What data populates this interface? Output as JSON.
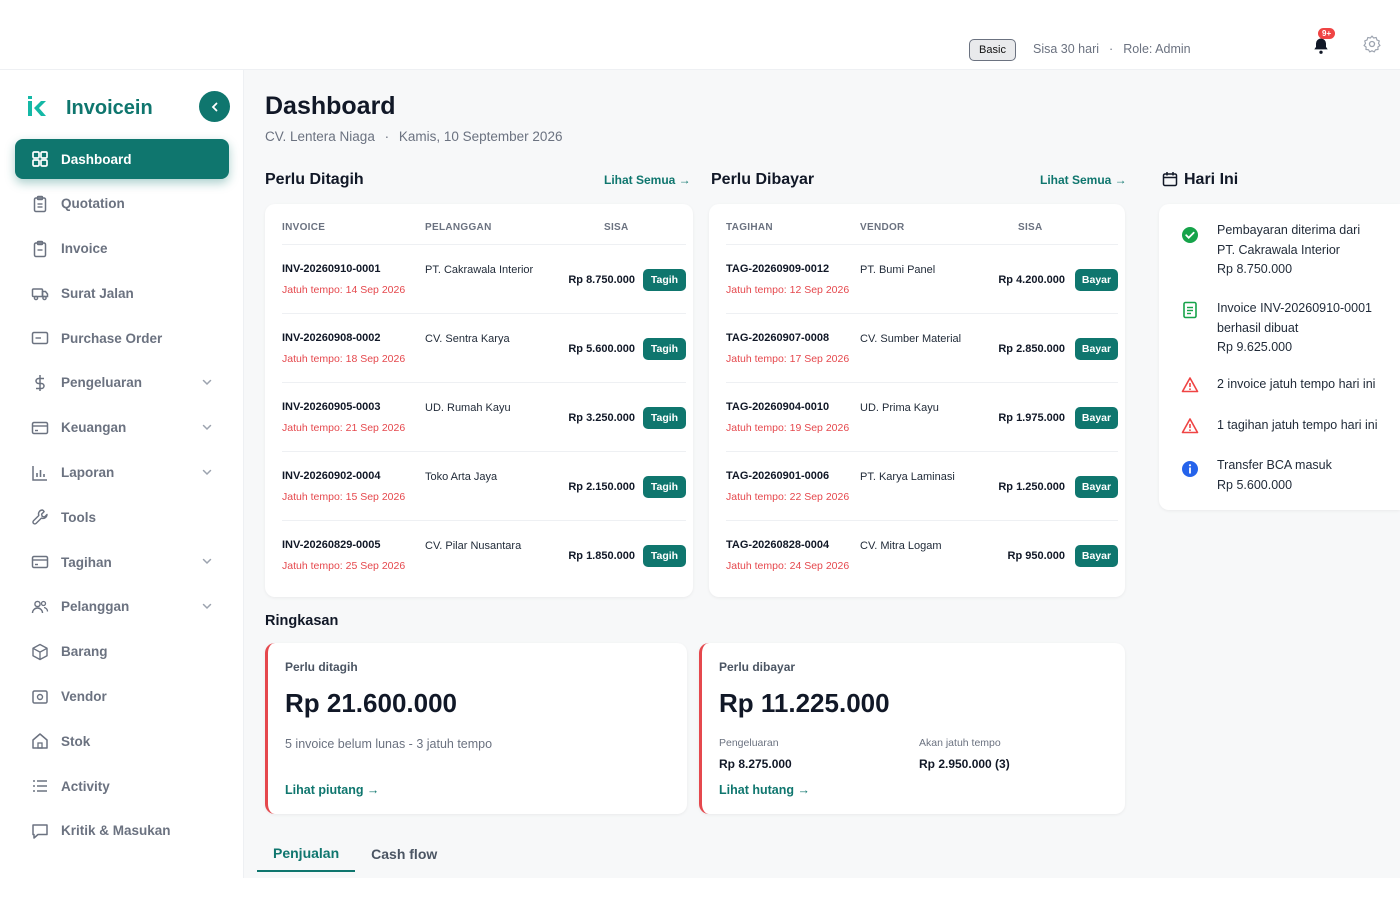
{
  "topbar": {
    "plan": "Basic",
    "trial": "Sisa 30 hari",
    "separator": "·",
    "role": "Role: Admin",
    "notif_count": "9+",
    "icons": [
      "bell-icon",
      "gear-icon"
    ]
  },
  "brand": {
    "name": "Invoicein",
    "color": "#0f766e"
  },
  "sidebar": {
    "items": [
      {
        "label": "Dashboard",
        "icon": "grid-icon",
        "active": true,
        "chevron": false
      },
      {
        "label": "Quotation",
        "icon": "clipboard-icon",
        "chevron": false
      },
      {
        "label": "Invoice",
        "icon": "invoice-icon",
        "chevron": false
      },
      {
        "label": "Surat Jalan",
        "icon": "truck-icon",
        "chevron": false
      },
      {
        "label": "Purchase Order",
        "icon": "card-icon",
        "chevron": false
      },
      {
        "label": "Pengeluaran",
        "icon": "dollar-icon",
        "chevron": true
      },
      {
        "label": "Keuangan",
        "icon": "wallet-icon",
        "chevron": true
      },
      {
        "label": "Laporan",
        "icon": "chart-icon",
        "chevron": true
      },
      {
        "label": "Tools",
        "icon": "wrench-icon",
        "chevron": false
      },
      {
        "label": "Tagihan",
        "icon": "bill-icon",
        "chevron": true
      },
      {
        "label": "Pelanggan",
        "icon": "users-icon",
        "chevron": true
      },
      {
        "label": "Barang",
        "icon": "box-icon",
        "chevron": false
      },
      {
        "label": "Vendor",
        "icon": "vendor-icon",
        "chevron": false
      },
      {
        "label": "Stok",
        "icon": "home-icon",
        "chevron": false
      },
      {
        "label": "Activity",
        "icon": "list-icon",
        "chevron": false
      },
      {
        "label": "Kritik & Masukan",
        "icon": "chat-icon",
        "chevron": false
      }
    ]
  },
  "header": {
    "title": "Dashboard",
    "company": "CV. Lentera Niaga",
    "separator": "·",
    "date": "Kamis, 10 September 2026"
  },
  "receivables": {
    "title": "Perlu Ditagih",
    "see_all": "Lihat Semua →",
    "columns": [
      "INVOICE",
      "PELANGGAN",
      "SISA"
    ],
    "rows": [
      {
        "code": "INV-20260910-0001",
        "due": "Jatuh tempo: 14 Sep 2026",
        "party": "PT. Cakrawala Interior",
        "amount": "Rp 8.750.000",
        "action": "Tagih"
      },
      {
        "code": "INV-20260908-0002",
        "due": "Jatuh tempo: 18 Sep 2026",
        "party": "CV. Sentra Karya",
        "amount": "Rp 5.600.000",
        "action": "Tagih"
      },
      {
        "code": "INV-20260905-0003",
        "due": "Jatuh tempo: 21 Sep 2026",
        "party": "UD. Rumah Kayu",
        "amount": "Rp 3.250.000",
        "action": "Tagih"
      },
      {
        "code": "INV-20260902-0004",
        "due": "Jatuh tempo: 15 Sep 2026",
        "party": "Toko Arta Jaya",
        "amount": "Rp 2.150.000",
        "action": "Tagih"
      },
      {
        "code": "INV-20260829-0005",
        "due": "Jatuh tempo: 25 Sep 2026",
        "party": "CV. Pilar Nusantara",
        "amount": "Rp 1.850.000",
        "action": "Tagih"
      }
    ]
  },
  "payables": {
    "title": "Perlu Dibayar",
    "see_all": "Lihat Semua →",
    "columns": [
      "TAGIHAN",
      "VENDOR",
      "SISA"
    ],
    "rows": [
      {
        "code": "TAG-20260909-0012",
        "due": "Jatuh tempo: 12 Sep 2026",
        "party": "PT. Bumi Panel",
        "amount": "Rp 4.200.000",
        "action": "Bayar"
      },
      {
        "code": "TAG-20260907-0008",
        "due": "Jatuh tempo: 17 Sep 2026",
        "party": "CV. Sumber Material",
        "amount": "Rp 2.850.000",
        "action": "Bayar"
      },
      {
        "code": "TAG-20260904-0010",
        "due": "Jatuh tempo: 19 Sep 2026",
        "party": "UD. Prima Kayu",
        "amount": "Rp 1.975.000",
        "action": "Bayar"
      },
      {
        "code": "TAG-20260901-0006",
        "due": "Jatuh tempo: 22 Sep 2026",
        "party": "PT. Karya Laminasi",
        "amount": "Rp 1.250.000",
        "action": "Bayar"
      },
      {
        "code": "TAG-20260828-0004",
        "due": "Jatuh tempo: 24 Sep 2026",
        "party": "CV. Mitra Logam",
        "amount": "Rp 950.000",
        "action": "Bayar"
      }
    ]
  },
  "today": {
    "title": "Hari Ini",
    "items": [
      {
        "icon": "check-circle-icon",
        "lines": [
          "Pembayaran diterima dari",
          "PT. Cakrawala Interior",
          "Rp 8.750.000"
        ]
      },
      {
        "icon": "document-icon",
        "lines": [
          "Invoice INV-20260910-0001",
          "berhasil dibuat",
          "Rp 9.625.000"
        ]
      },
      {
        "icon": "warning-icon",
        "lines": [
          "2 invoice jatuh tempo hari ini"
        ]
      },
      {
        "icon": "warning-icon",
        "lines": [
          "1 tagihan jatuh tempo hari ini"
        ]
      },
      {
        "icon": "info-icon",
        "lines": [
          "Transfer BCA masuk",
          "Rp 5.600.000"
        ]
      }
    ]
  },
  "summary": {
    "title": "Ringkasan",
    "receivable": {
      "label": "Perlu ditagih",
      "value": "Rp 21.600.000",
      "note": "5 invoice belum lunas - 3 jatuh tempo",
      "link": "Lihat piutang →"
    },
    "payable": {
      "label": "Perlu dibayar",
      "value": "Rp 11.225.000",
      "expense_label": "Pengeluaran",
      "expense_value": "Rp 8.275.000",
      "due_label": "Akan jatuh tempo",
      "due_value": "Rp 2.950.000 (3)",
      "link": "Lihat hutang →"
    }
  },
  "tabs": [
    {
      "label": "Penjualan",
      "active": true
    },
    {
      "label": "Cash flow",
      "active": false
    }
  ],
  "colors": {
    "accent": "#0f766e",
    "danger": "#e5484d",
    "warning": "#ef4444",
    "info": "#2563eb",
    "success": "#16a34a"
  }
}
